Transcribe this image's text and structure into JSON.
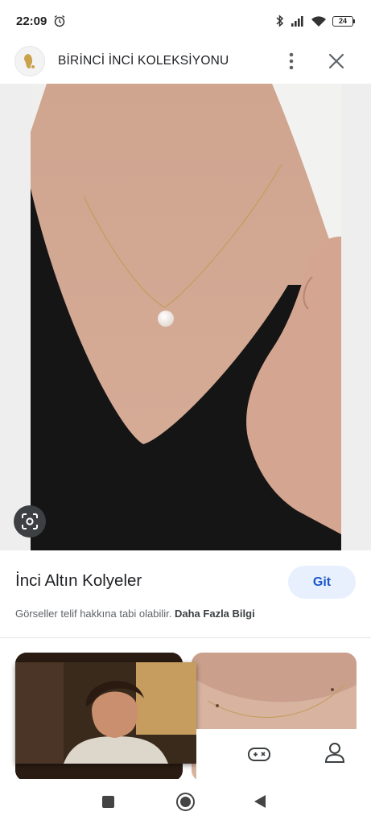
{
  "status_bar": {
    "time": "22:09",
    "battery": "24",
    "icons": [
      "alarm-icon",
      "bluetooth-icon",
      "signal-icon",
      "wifi-icon",
      "battery-icon"
    ]
  },
  "header": {
    "title": "BİRİNCİ İNCİ KOLEKSİYONU",
    "logo_icon": "pearl-logo-icon",
    "more_icon": "more-vert-icon",
    "close_icon": "close-icon"
  },
  "image": {
    "subject": "pearl-necklace-photo",
    "lens_icon": "lens-search-icon"
  },
  "info": {
    "title": "İnci Altın Kolyeler",
    "visit_label": "Git",
    "copyright_text": "Görseller telif hakkına tabi olabilir.",
    "more_info_label": "Daha Fazla Bilgi"
  },
  "bottom_nav": {
    "icons": [
      "gamepad-icon",
      "profile-icon"
    ]
  },
  "system_nav": {
    "icons": [
      "recents-icon",
      "home-icon",
      "back-icon"
    ]
  },
  "colors": {
    "accent": "#1a57c9",
    "visit_bg": "#e8f0fe",
    "image_bg": "#eeeeee"
  }
}
